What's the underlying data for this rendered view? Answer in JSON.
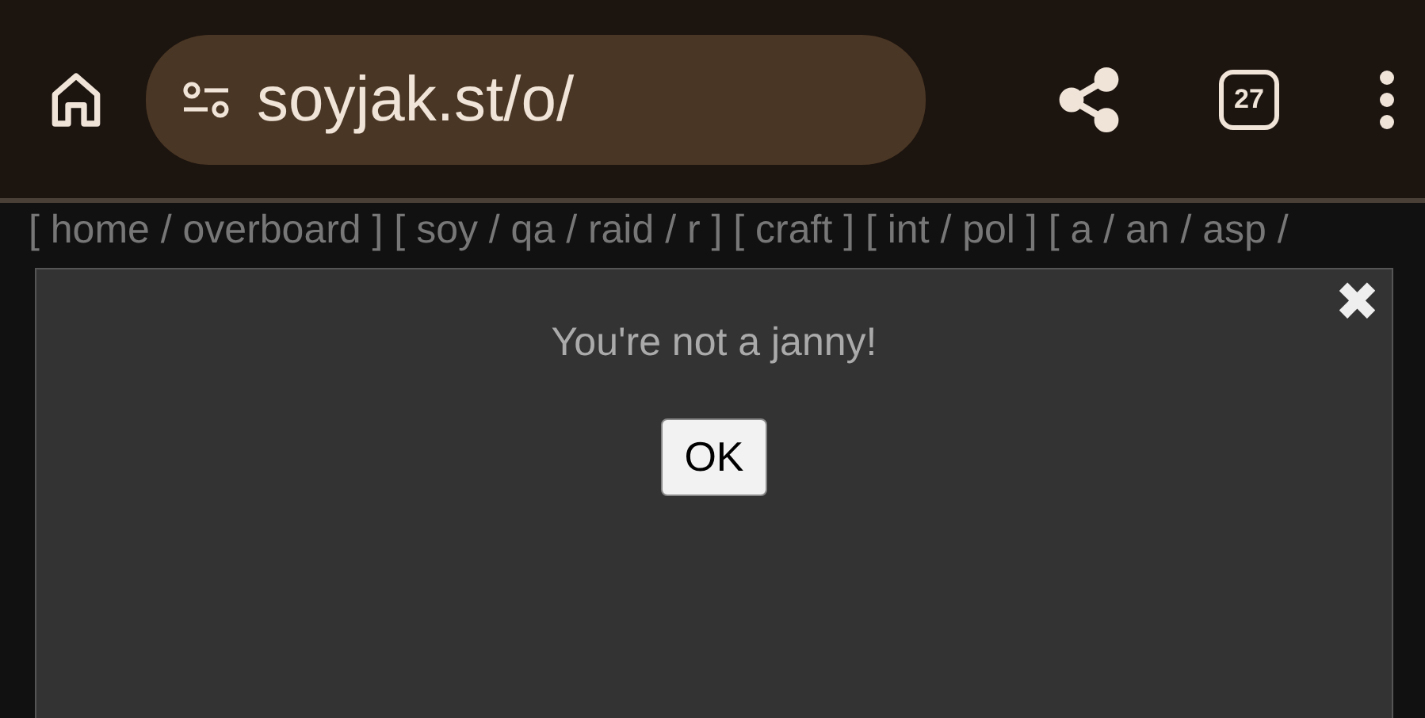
{
  "browser_toolbar": {
    "url": "soyjak.st/o/",
    "tab_count": "27"
  },
  "board_nav": "[ home / overboard ] [ soy / qa / raid / r ] [ craft ] [ int / pol ] [ a / an / asp /",
  "dialog": {
    "close": "✖",
    "message": "You're not a janny!",
    "button": "OK"
  }
}
